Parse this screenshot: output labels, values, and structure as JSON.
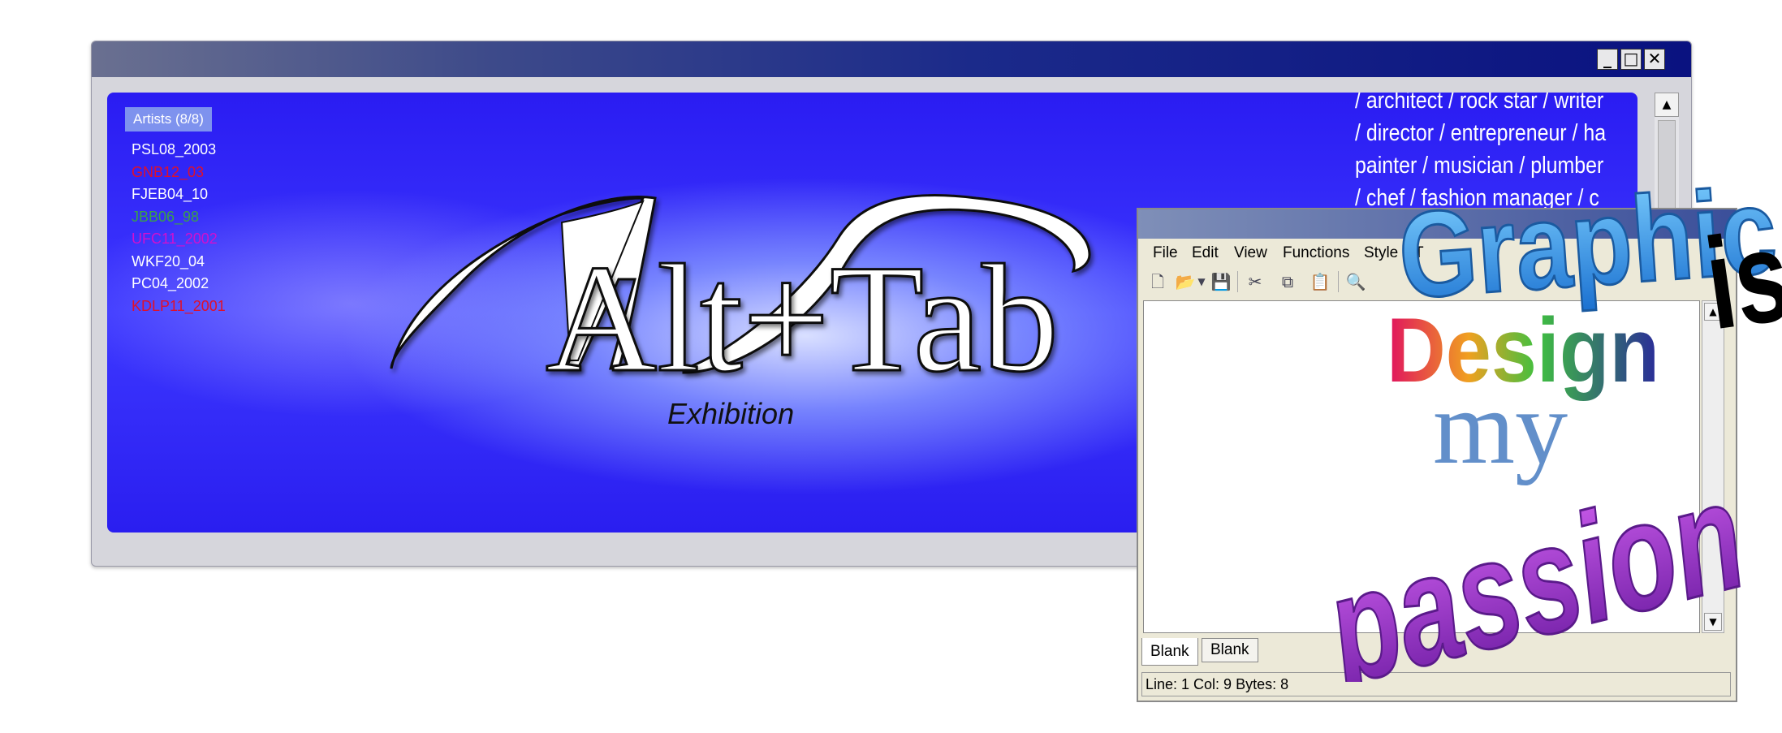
{
  "main_window": {
    "controls": {
      "minimize": "_",
      "maximize": "□",
      "close": "✕"
    },
    "artists_tab": "Artists (8/8)",
    "artists": [
      {
        "name": "PSL08_2003",
        "color": "#ffffff"
      },
      {
        "name": "GNB12_03",
        "color": "#e0102a"
      },
      {
        "name": "FJEB04_10",
        "color": "#ffffff"
      },
      {
        "name": "JBB06_98",
        "color": "#3aa04a"
      },
      {
        "name": "UFC11_2002",
        "color": "#d010d0"
      },
      {
        "name": "WKF20_04",
        "color": "#ffffff"
      },
      {
        "name": "PC04_2002",
        "color": "#ffffff"
      },
      {
        "name": "KDLP11_2001",
        "color": "#e0102a"
      }
    ],
    "logo": {
      "title": "Alt+Tab",
      "subtitle": "Exhibition"
    },
    "roles_lines": [
      "/ architect / rock star / writer",
      "/ director / entrepreneur / ha",
      "painter / musician / plumber",
      "/ chef / fashion manager / c"
    ]
  },
  "editor": {
    "menu": [
      "File",
      "Edit",
      "View",
      "Functions",
      "Style",
      "T"
    ],
    "toolbar_icons": [
      "new-file-icon",
      "open-folder-icon",
      "dropdown-arrow-icon",
      "save-icon",
      "cut-icon",
      "copy-icon",
      "paste-icon",
      "find-icon"
    ],
    "tabs": [
      "Blank",
      "Blank"
    ],
    "status": "Line: 1  Col: 9  Bytes: 8"
  },
  "graphic": {
    "words": [
      "Graphic",
      "Design",
      "is",
      "my",
      "passion"
    ],
    "colors": {
      "graphic": "#3aa0e8",
      "design_start": "#e01060",
      "design_end": "#2a2a9a",
      "is": "#000000",
      "my": "#4a7ab8",
      "passion": "#9a2ad0"
    }
  }
}
